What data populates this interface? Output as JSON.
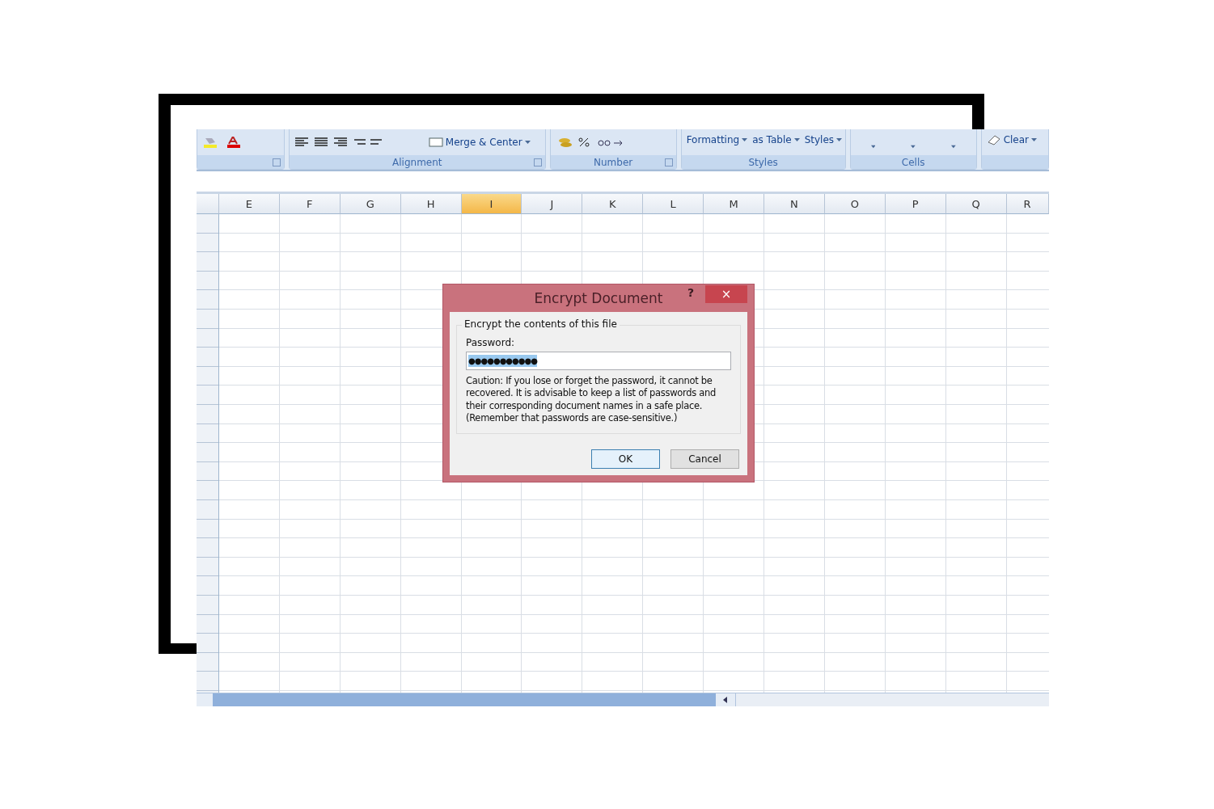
{
  "ribbon": {
    "groups": [
      {
        "kind": "font"
      },
      {
        "kind": "alignment",
        "label": "Alignment",
        "buttons": [
          "Merge & Center"
        ]
      },
      {
        "kind": "number",
        "label": "Number"
      },
      {
        "kind": "styles",
        "label": "Styles",
        "buttons": [
          "Formatting",
          "as Table",
          "Styles"
        ]
      },
      {
        "kind": "cells",
        "label": "Cells"
      },
      {
        "kind": "editing",
        "buttons": [
          "Clear"
        ]
      }
    ]
  },
  "columns": [
    {
      "label": "E",
      "selected": false
    },
    {
      "label": "F",
      "selected": false
    },
    {
      "label": "G",
      "selected": false
    },
    {
      "label": "H",
      "selected": false
    },
    {
      "label": "I",
      "selected": true
    },
    {
      "label": "J",
      "selected": false
    },
    {
      "label": "K",
      "selected": false
    },
    {
      "label": "L",
      "selected": false
    },
    {
      "label": "M",
      "selected": false
    },
    {
      "label": "N",
      "selected": false
    },
    {
      "label": "O",
      "selected": false
    },
    {
      "label": "P",
      "selected": false
    },
    {
      "label": "Q",
      "selected": false
    },
    {
      "label": "R",
      "selected": false
    }
  ],
  "dialog": {
    "title": "Encrypt Document",
    "help": "?",
    "close": "×",
    "group_label": "Encrypt the contents of this file",
    "password_label": "Password:",
    "password_value": "●●●●●●●●●●●",
    "caution": "Caution: If you lose or forget the password, it cannot be recovered. It is advisable to keep a list of passwords and their corresponding document names in a safe place. (Remember that passwords are case-sensitive.)",
    "buttons": [
      {
        "label": "OK",
        "default": true
      },
      {
        "label": "Cancel",
        "default": false
      }
    ]
  }
}
